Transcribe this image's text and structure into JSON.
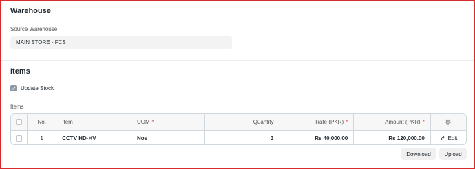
{
  "warehouse_section": {
    "title": "Warehouse",
    "source_warehouse_label": "Source Warehouse",
    "source_warehouse_value": "MAIN STORE - FCS"
  },
  "items_section": {
    "title": "Items",
    "update_stock_label": "Update Stock",
    "update_stock_checked": true,
    "table_label": "Items"
  },
  "table": {
    "headers": {
      "no": "No.",
      "item": "Item",
      "uom": "UOM",
      "quantity": "Quantity",
      "rate": "Rate (PKR)",
      "amount": "Amount (PKR)",
      "required_mark": "*"
    },
    "rows": [
      {
        "no": "1",
        "item": "CCTV HD-HV",
        "uom": "Nos",
        "quantity": "3",
        "rate": "Rs 40,000.00",
        "amount": "Rs 120,000.00",
        "action": "Edit"
      }
    ]
  },
  "actions": {
    "download_label": "Download",
    "upload_label": "Upload"
  },
  "colors": {
    "frame_border": "#d92b2b",
    "required": "#e24c4c",
    "field_bg": "#f3f3f3",
    "grid_border": "#d1d8dd"
  },
  "icons": {
    "settings": "gear-icon",
    "edit": "pencil-icon",
    "checkbox": "check-icon"
  }
}
